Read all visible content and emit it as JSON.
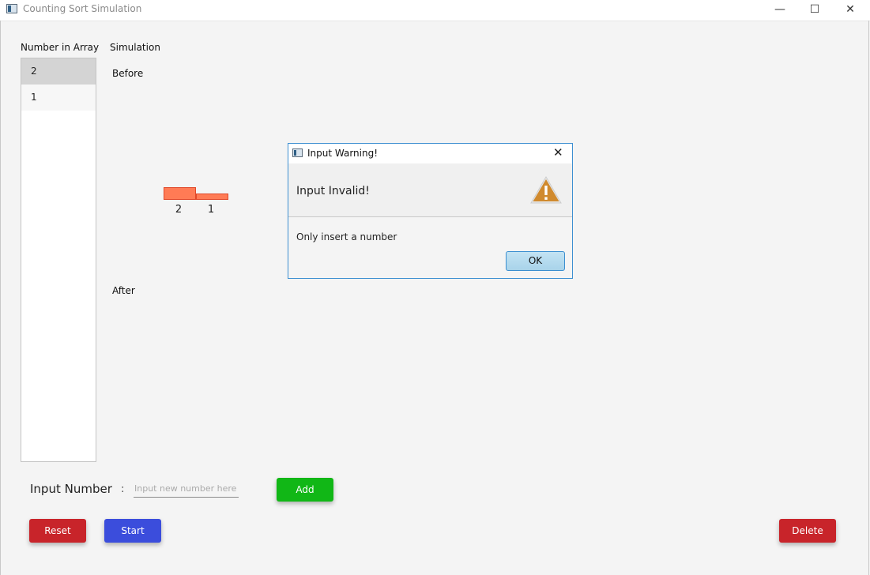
{
  "window": {
    "title": "Counting Sort Simulation",
    "minimize": "—",
    "maximize": "☐",
    "close": "✕"
  },
  "sidebar": {
    "title": "Number in Array",
    "items": [
      "2",
      "1"
    ]
  },
  "simulation": {
    "title": "Simulation",
    "before_label": "Before",
    "after_label": "After",
    "bars": [
      {
        "value": "2",
        "height_units": 2
      },
      {
        "value": "1",
        "height_units": 1
      }
    ],
    "bar_color": "#ff7b55"
  },
  "input": {
    "label": "Input Number",
    "colon": ":",
    "placeholder": "Input new number here",
    "value": ""
  },
  "buttons": {
    "add": "Add",
    "reset": "Reset",
    "start": "Start",
    "delete": "Delete"
  },
  "dialog": {
    "title": "Input Warning!",
    "close": "✕",
    "header": "Input Invalid!",
    "content": "Only insert a number",
    "ok": "OK"
  },
  "colors": {
    "add": "#11b716",
    "reset": "#c8242a",
    "start": "#3b4ddc",
    "delete": "#c8242a",
    "dialog_border": "#3d8fd1"
  }
}
